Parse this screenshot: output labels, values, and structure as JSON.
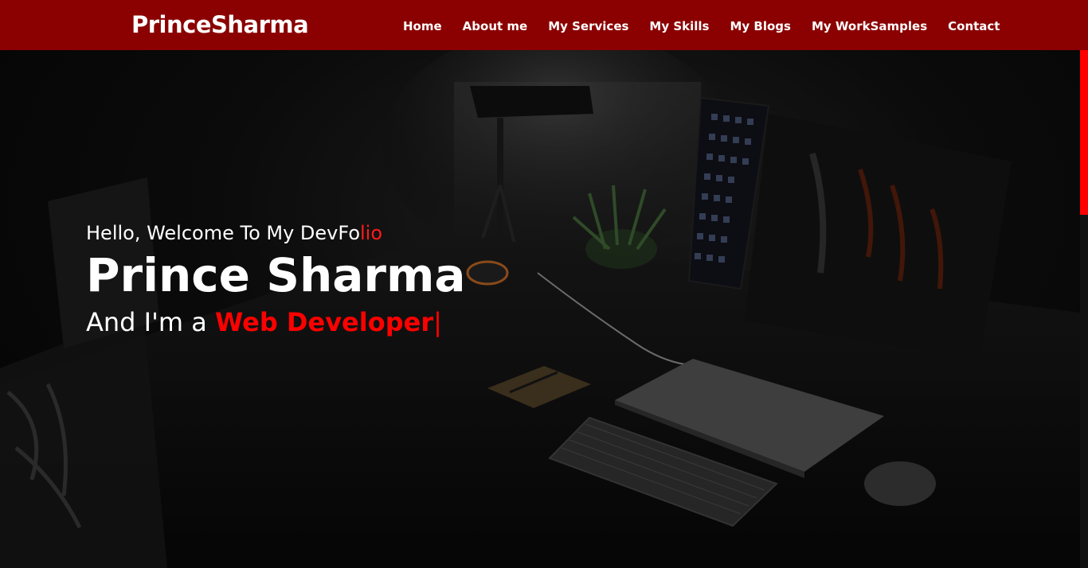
{
  "nav": {
    "brand": "PrinceSharma",
    "links": [
      "Home",
      "About me",
      "My Services",
      "My Skills",
      "My Blogs",
      "My WorkSamples",
      "Contact"
    ]
  },
  "hero": {
    "greeting_main": "Hello, Welcome To My DevFo",
    "greeting_accent": "lio",
    "name": "Prince Sharma",
    "tagline_prefix": "And I'm a ",
    "role": "Web Developer",
    "cursor": "|"
  },
  "colors": {
    "navbar": "#8b0000",
    "accent": "#ff0000",
    "text": "#ffffff",
    "background": "#000000"
  },
  "icons": {
    "background": "desk-setup-photo"
  }
}
